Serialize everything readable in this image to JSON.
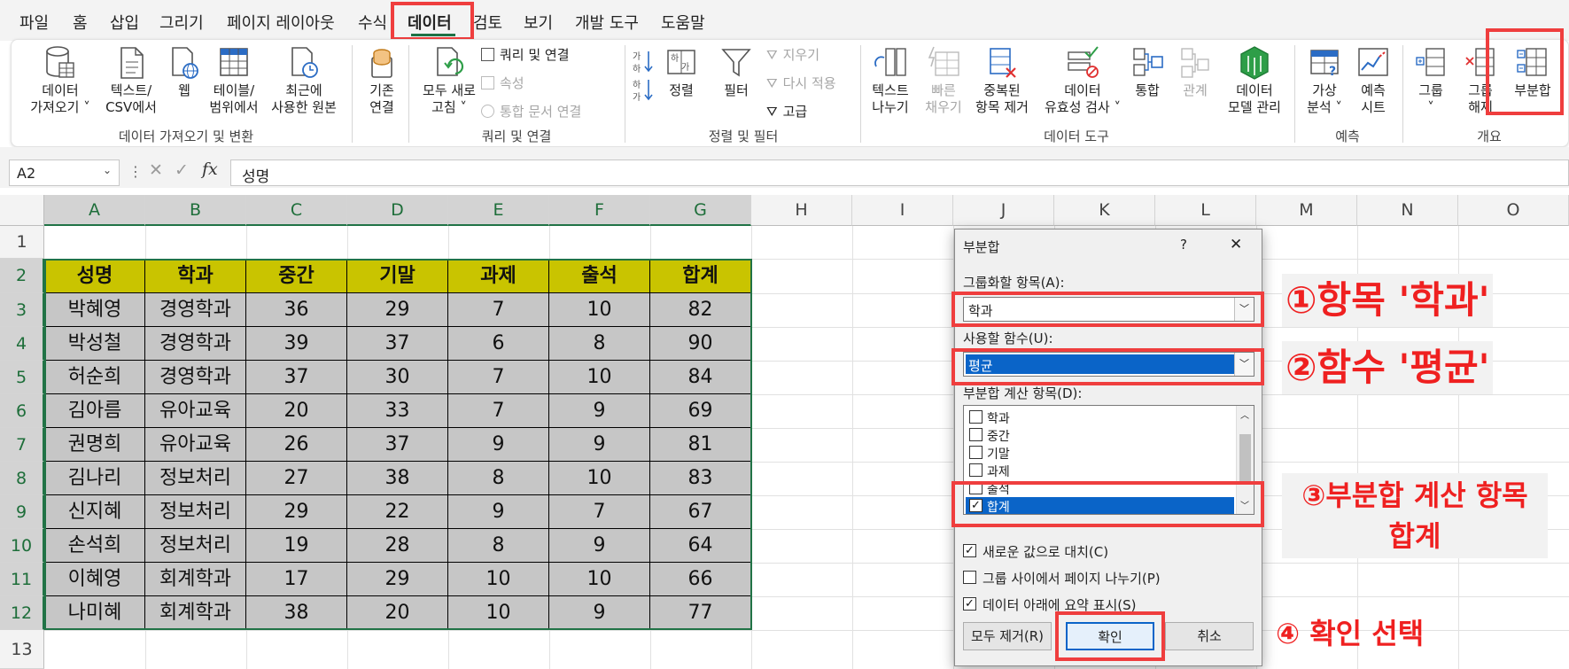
{
  "menu": {
    "tabs": [
      "파일",
      "홈",
      "삽입",
      "그리기",
      "페이지 레이아웃",
      "수식",
      "데이터",
      "검토",
      "보기",
      "개발 도구",
      "도움말"
    ],
    "active_tab": "데이터"
  },
  "ribbon": {
    "buttons": {
      "get_data": [
        "데이터",
        "가져오기 ˅"
      ],
      "text_csv": [
        "텍스트/",
        "CSV에서"
      ],
      "web": [
        "웹"
      ],
      "table_range": [
        "테이블/",
        "범위에서"
      ],
      "recent_sources": [
        "최근에",
        "사용한 원본"
      ],
      "existing": [
        "기존",
        "연결"
      ],
      "refresh_all": [
        "모두 새로",
        "고침 ˅"
      ],
      "sort": [
        "정렬"
      ],
      "filter": [
        "필터"
      ],
      "text_to_columns": [
        "텍스트",
        "나누기"
      ],
      "flash_fill": [
        "빠른",
        "채우기"
      ],
      "remove_dup": [
        "중복된",
        "항목 제거"
      ],
      "validation": [
        "데이터",
        "유효성 검사 ˅"
      ],
      "consolidate": [
        "통합"
      ],
      "relationships": [
        "관계"
      ],
      "data_model": [
        "데이터",
        "모델 관리"
      ],
      "what_if": [
        "가상",
        "분석 ˅"
      ],
      "forecast": [
        "예측",
        "시트"
      ],
      "group": [
        "그룹",
        "˅"
      ],
      "ungroup": [
        "그룹",
        "해제"
      ],
      "subtotal": [
        "부분합"
      ]
    },
    "small": {
      "queries": "쿼리 및 연결",
      "properties": "속성",
      "edit_links": "통합 문서 연결",
      "clear": "지우기",
      "reapply": "다시 적용",
      "advanced": "고급"
    },
    "groups": [
      "데이터 가져오기 및 변환",
      "쿼리 및 연결",
      "정렬 및 필터",
      "데이터 도구",
      "예측",
      "개요"
    ]
  },
  "formula_bar": {
    "name_box": "A2",
    "fx": "fx",
    "content": "성명"
  },
  "columns": [
    "A",
    "B",
    "C",
    "D",
    "E",
    "F",
    "G",
    "H",
    "I",
    "J",
    "K",
    "L",
    "M",
    "N",
    "O"
  ],
  "rows": [
    "1",
    "2",
    "3",
    "4",
    "5",
    "6",
    "7",
    "8",
    "9",
    "10",
    "11",
    "12",
    "13"
  ],
  "table": {
    "headers": [
      "성명",
      "학과",
      "중간",
      "기말",
      "과제",
      "출석",
      "합계"
    ],
    "rows": [
      [
        "박혜영",
        "경영학과",
        "36",
        "29",
        "7",
        "10",
        "82"
      ],
      [
        "박성철",
        "경영학과",
        "39",
        "37",
        "6",
        "8",
        "90"
      ],
      [
        "허순희",
        "경영학과",
        "37",
        "30",
        "7",
        "10",
        "84"
      ],
      [
        "김아름",
        "유아교육",
        "20",
        "33",
        "7",
        "9",
        "69"
      ],
      [
        "권명희",
        "유아교육",
        "26",
        "37",
        "9",
        "9",
        "81"
      ],
      [
        "김나리",
        "정보처리",
        "27",
        "38",
        "8",
        "10",
        "83"
      ],
      [
        "신지혜",
        "정보처리",
        "29",
        "22",
        "9",
        "7",
        "67"
      ],
      [
        "손석희",
        "정보처리",
        "19",
        "28",
        "8",
        "9",
        "64"
      ],
      [
        "이혜영",
        "회계학과",
        "17",
        "29",
        "10",
        "10",
        "66"
      ],
      [
        "나미혜",
        "회계학과",
        "38",
        "20",
        "10",
        "9",
        "77"
      ]
    ]
  },
  "dialog": {
    "title": "부분합",
    "help": "?",
    "close": "✕",
    "group_by_label": "그룹화할 항목(A):",
    "group_by_value": "학과",
    "function_label": "사용할 함수(U):",
    "function_value": "평균",
    "fields_label": "부분합 계산 항목(D):",
    "fields": [
      {
        "label": "학과",
        "checked": false
      },
      {
        "label": "중간",
        "checked": false
      },
      {
        "label": "기말",
        "checked": false
      },
      {
        "label": "과제",
        "checked": false
      },
      {
        "label": "출석",
        "checked": false
      },
      {
        "label": "합계",
        "checked": true
      }
    ],
    "options": [
      {
        "label": "새로운 값으로 대치(C)",
        "checked": true
      },
      {
        "label": "그룹 사이에서 페이지 나누기(P)",
        "checked": false
      },
      {
        "label": "데이터 아래에 요약 표시(S)",
        "checked": true
      }
    ],
    "remove_all": "모두 제거(R)",
    "ok": "확인",
    "cancel": "취소"
  },
  "annotations": {
    "a1": "①항목 '학과'",
    "a2": "②함수 '평균'",
    "a3_line1": "③부분합 계산 항목",
    "a3_line2": "합계",
    "a4": "④ 확인 선택"
  },
  "colors": {
    "accent": "#217346",
    "highlight": "#ef3e3e",
    "header_fill": "#c9c400",
    "body_fill": "#c6c6c6",
    "selection": "#0a64c8"
  }
}
